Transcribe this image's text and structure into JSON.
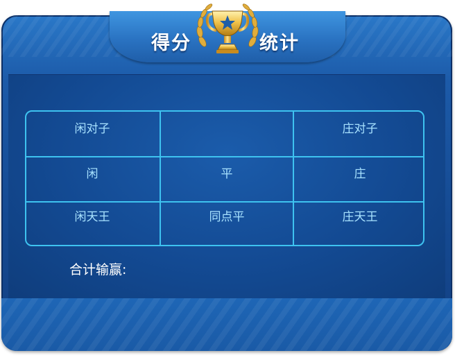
{
  "header": {
    "title_left": "得分",
    "title_right": "统计"
  },
  "grid": {
    "cells": {
      "player_pair": "闲对子",
      "banker_pair": "庄对子",
      "player": "闲",
      "tie": "平",
      "banker": "庄",
      "player_natural": "闲天王",
      "same_point_tie": "同点平",
      "banker_natural": "庄天王"
    }
  },
  "summary": {
    "total_label": "合计输赢:"
  },
  "colors": {
    "panel_blue": "#154a92",
    "grid_line": "#3ec3f0",
    "cell_text": "#a8e2ff",
    "trophy_gold": "#e8b23a"
  },
  "icons": {
    "trophy": "trophy-icon",
    "laurel": "laurel-icon",
    "star": "star-icon"
  }
}
